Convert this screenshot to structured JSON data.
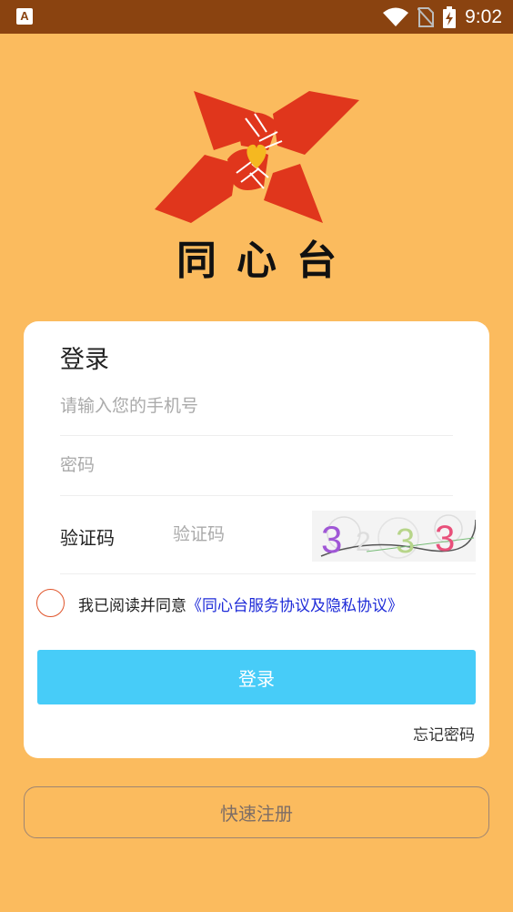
{
  "status_bar": {
    "app_icon_letter": "A",
    "time": "9:02",
    "background_color": "#8A4310"
  },
  "logo": {
    "text": "同心台",
    "hands_color": "#E0361C",
    "heart_color": "#F5B820"
  },
  "login_card": {
    "title": "登录",
    "phone_placeholder": "请输入您的手机号",
    "password_placeholder": "密码",
    "captcha_label": "验证码",
    "captcha_placeholder": "验证码",
    "captcha_text": "3233",
    "agreement_prefix": "我已阅读并同意",
    "agreement_link": "《同心台服务协议及隐私协议》",
    "login_button": "登录",
    "forgot_password": "忘记密码"
  },
  "register_button": "快速注册",
  "colors": {
    "page_background": "#FBBB5E",
    "login_button": "#47CCF8",
    "link": "#1E2BD8",
    "radio_border": "#E0542A"
  }
}
